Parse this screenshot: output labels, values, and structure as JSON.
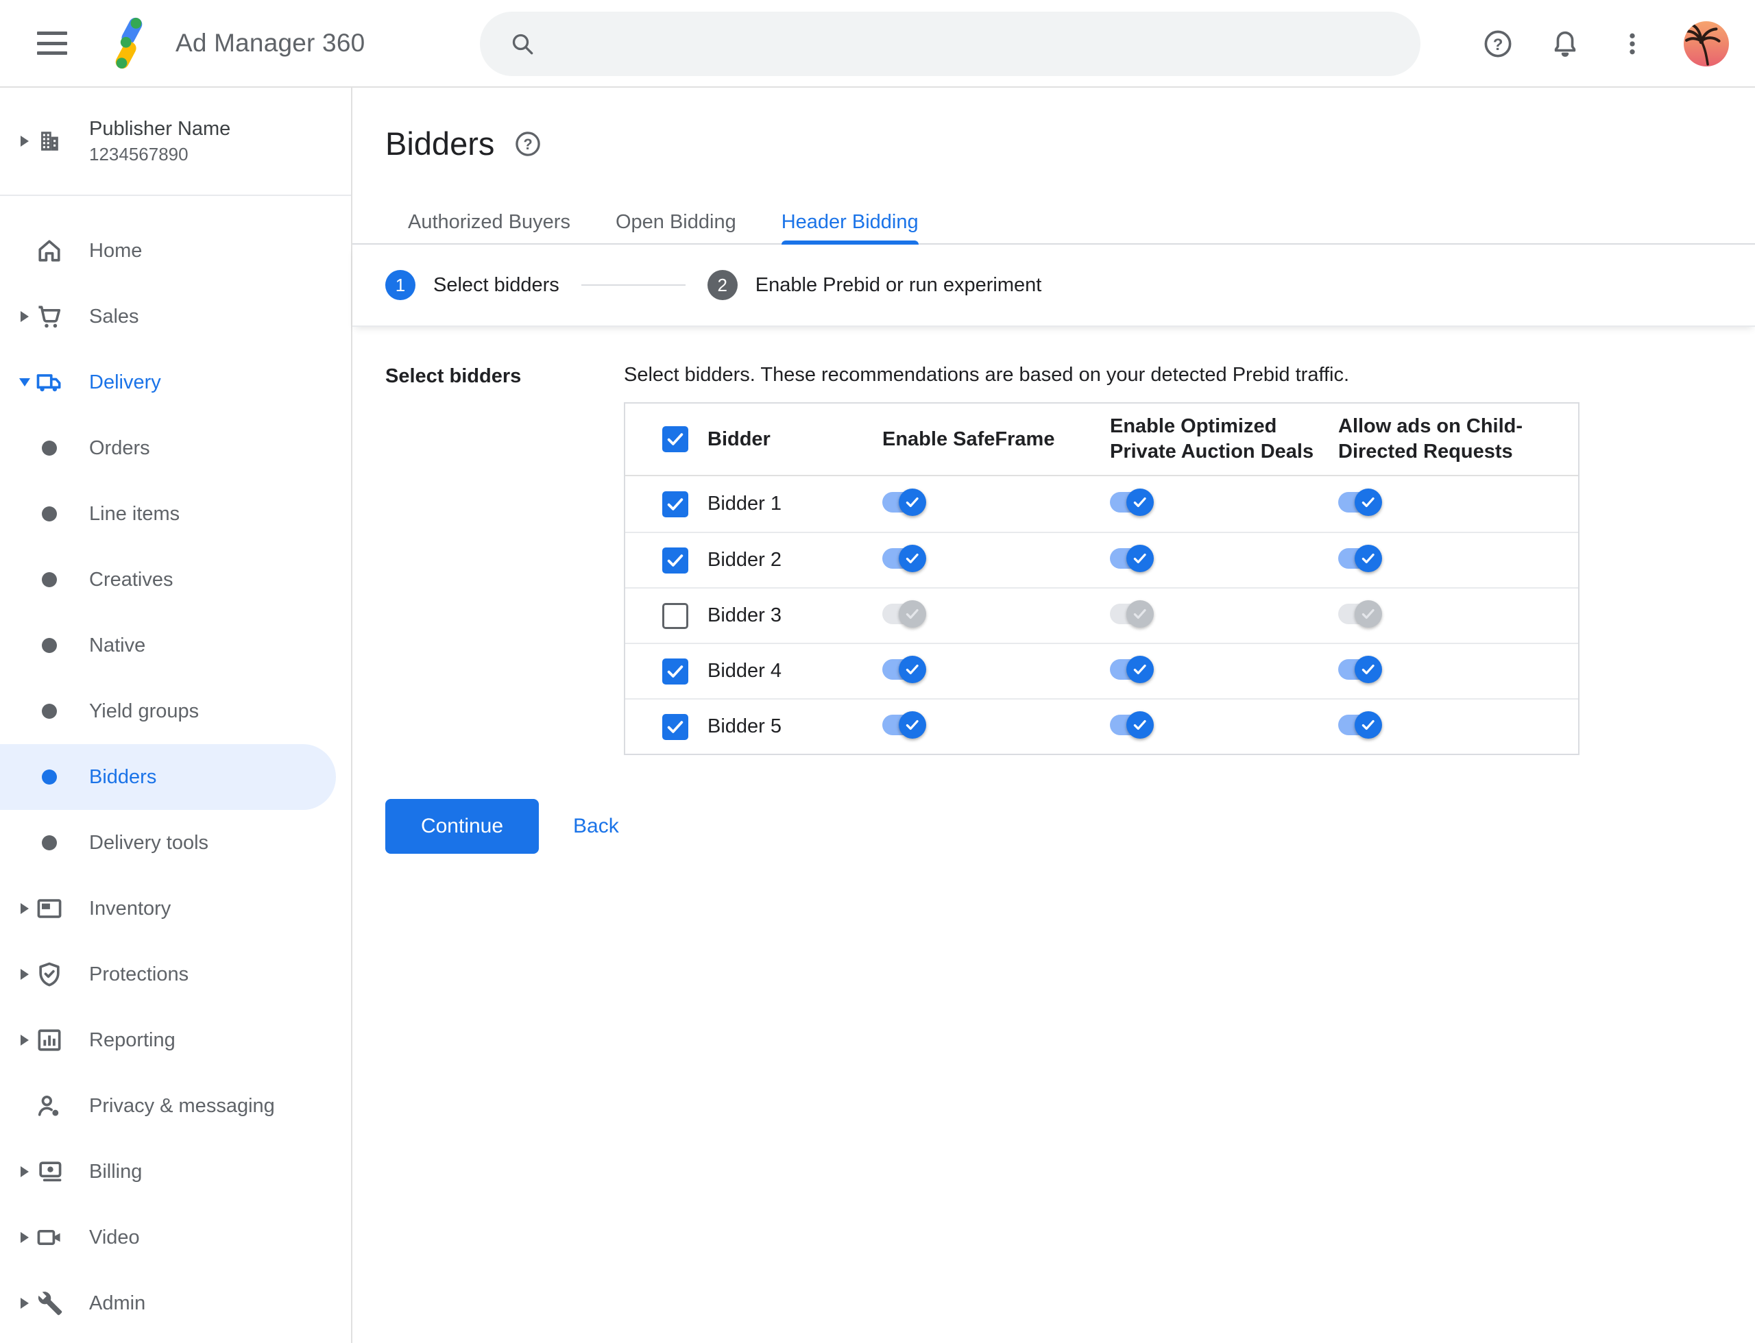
{
  "topbar": {
    "product_name": "Ad Manager 360",
    "search": {
      "placeholder": "",
      "value": ""
    },
    "icons": [
      "menu-icon",
      "ad-manager-logo",
      "search-icon",
      "help-icon",
      "notifications-icon",
      "more-vert-icon",
      "avatar-palm-tree"
    ]
  },
  "publisher": {
    "name": "Publisher Name",
    "code": "1234567890"
  },
  "sidebar": {
    "items": [
      {
        "label": "Home"
      },
      {
        "label": "Sales"
      },
      {
        "label": "Delivery",
        "expanded": true
      },
      {
        "label": "Orders"
      },
      {
        "label": "Line items"
      },
      {
        "label": "Creatives"
      },
      {
        "label": "Native"
      },
      {
        "label": "Yield groups"
      },
      {
        "label": "Bidders",
        "selected": true
      },
      {
        "label": "Delivery tools"
      },
      {
        "label": "Inventory"
      },
      {
        "label": "Protections"
      },
      {
        "label": "Reporting"
      },
      {
        "label": "Privacy & messaging"
      },
      {
        "label": "Billing"
      },
      {
        "label": "Video"
      },
      {
        "label": "Admin"
      }
    ]
  },
  "page": {
    "title": "Bidders"
  },
  "tabs": {
    "items": [
      {
        "label": "Authorized Buyers",
        "active": false
      },
      {
        "label": "Open Bidding",
        "active": false
      },
      {
        "label": "Header Bidding",
        "active": true
      }
    ]
  },
  "stepper": {
    "steps": [
      {
        "number": "1",
        "label": "Select bidders",
        "active": true
      },
      {
        "number": "2",
        "label": "Enable Prebid or run experiment",
        "active": false
      }
    ]
  },
  "section": {
    "label": "Select bidders",
    "description": "Select bidders. These recommendations are based on your detected Prebid traffic."
  },
  "table": {
    "select_all_checked": true,
    "columns": [
      "Bidder",
      "Enable SafeFrame",
      "Enable Optimized Private Auction Deals",
      "Allow ads on Child-Directed Requests"
    ],
    "rows": [
      {
        "name": "Bidder 1",
        "checked": true,
        "enable_safeframe": true,
        "enable_optimized_deals": true,
        "allow_child_directed": true
      },
      {
        "name": "Bidder 2",
        "checked": true,
        "enable_safeframe": true,
        "enable_optimized_deals": true,
        "allow_child_directed": true
      },
      {
        "name": "Bidder 3",
        "checked": false,
        "enable_safeframe": true,
        "enable_optimized_deals": true,
        "allow_child_directed": true
      },
      {
        "name": "Bidder 4",
        "checked": true,
        "enable_safeframe": true,
        "enable_optimized_deals": true,
        "allow_child_directed": true
      },
      {
        "name": "Bidder 5",
        "checked": true,
        "enable_safeframe": true,
        "enable_optimized_deals": true,
        "allow_child_directed": true
      }
    ]
  },
  "actions": {
    "continue_label": "Continue",
    "back_label": "Back"
  },
  "colors": {
    "accent_blue": "#1a73e8",
    "toggle_track_on": "#8ab4f8",
    "selected_item_bg": "#e8f0fe",
    "icon_gray": "#5f6368",
    "text_dark": "#202124",
    "table_border": "#dadce0"
  }
}
